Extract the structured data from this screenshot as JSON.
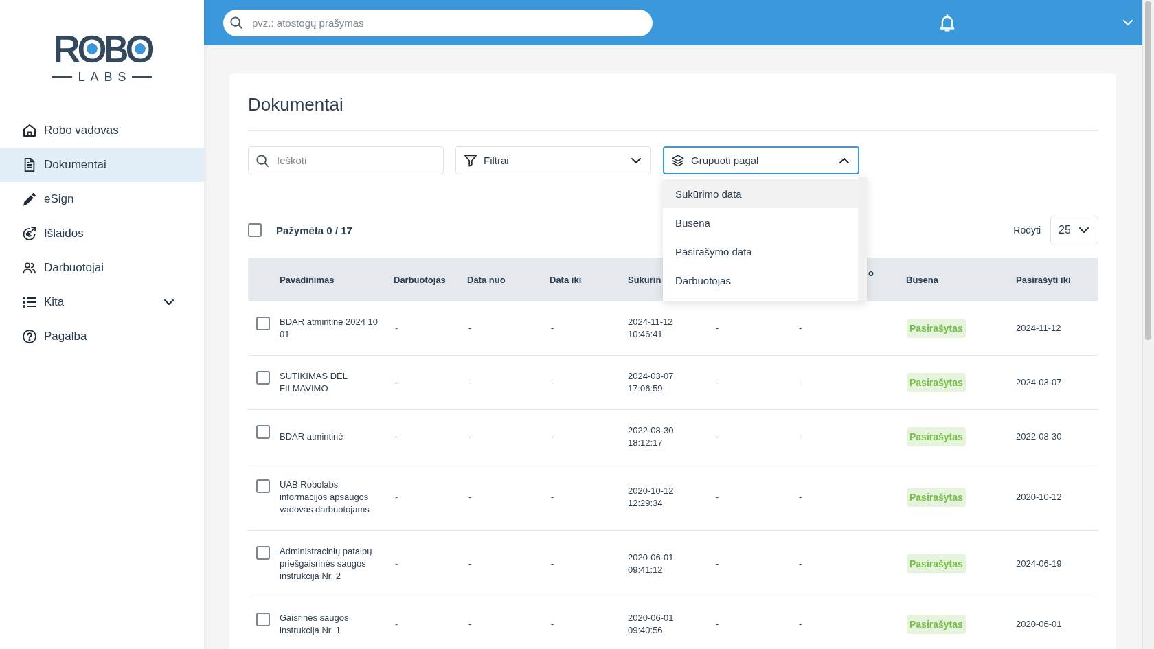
{
  "sidebar": {
    "logo": {
      "wordmark": "ROBO",
      "tagline": "LABS"
    },
    "items": [
      {
        "label": "Robo vadovas",
        "kind": "link",
        "selected": false
      },
      {
        "label": "Dokumentai",
        "kind": "link",
        "selected": true
      },
      {
        "label": "eSign",
        "kind": "link",
        "selected": false
      },
      {
        "label": "Išlaidos",
        "kind": "link",
        "selected": false
      },
      {
        "label": "Darbuotojai",
        "kind": "link",
        "selected": false
      },
      {
        "label": "Kita",
        "kind": "group",
        "selected": false,
        "expanded": false
      },
      {
        "label": "Pagalba",
        "kind": "link",
        "selected": false
      }
    ]
  },
  "topbar": {
    "search": {
      "placeholder": "pvz.: atostogų prašymas"
    }
  },
  "page": {
    "title": "Dokumentai"
  },
  "toolbar": {
    "search": {
      "placeholder": "Ieškoti"
    },
    "filters": {
      "label": "Filtrai",
      "expanded": false
    },
    "group_by": {
      "label": "Grupuoti pagal",
      "expanded": true,
      "options": [
        {
          "label": "Sukūrimo data",
          "selected": true
        },
        {
          "label": "Būsena",
          "selected": false
        },
        {
          "label": "Pasirašymo data",
          "selected": false
        },
        {
          "label": "Darbuotojas",
          "selected": false
        }
      ]
    }
  },
  "selection": {
    "checked": false,
    "label": "Pažymėta 0 / 17"
  },
  "page_size": {
    "label": "Rodyti",
    "value": "25"
  },
  "table": {
    "columns": [
      {
        "label": "Pavadinimas",
        "kind": "name"
      },
      {
        "label": "Darbuotojas",
        "kind": "text"
      },
      {
        "label": "Data nuo",
        "kind": "text"
      },
      {
        "label": "Data iki",
        "kind": "text"
      },
      {
        "label": "Sukūrin",
        "kind": "datetime"
      },
      {
        "kind": "text"
      },
      {
        "label": "o",
        "kind": "text"
      },
      {
        "label": "Būsena",
        "kind": "status"
      },
      {
        "label": "Pasirašyti iki",
        "kind": "date"
      }
    ],
    "rows": [
      {
        "checked": false,
        "cells": [
          "BDAR atmintinė 2024 10 01",
          "-",
          "-",
          "-",
          "2024-11-12 10:46:41",
          "-",
          "-",
          "Pasirašytas",
          "2024-11-12"
        ]
      },
      {
        "checked": false,
        "cells": [
          "SUTIKIMAS DĖL FILMAVIMO",
          "-",
          "-",
          "-",
          "2024-03-07 17:06:59",
          "-",
          "-",
          "Pasirašytas",
          "2024-03-07"
        ]
      },
      {
        "checked": false,
        "cells": [
          "BDAR atmintinė",
          "-",
          "-",
          "-",
          "2022-08-30 18:12:17",
          "-",
          "-",
          "Pasirašytas",
          "2022-08-30"
        ]
      },
      {
        "checked": false,
        "cells": [
          "UAB Robolabs informacijos apsaugos vadovas darbuotojams",
          "-",
          "-",
          "-",
          "2020-10-12 12:29:34",
          "-",
          "-",
          "Pasirašytas",
          "2020-10-12"
        ]
      },
      {
        "checked": false,
        "cells": [
          "Administracinių patalpų priešgaisrinės saugos instrukcija Nr. 2",
          "-",
          "-",
          "-",
          "2020-06-01 09:41:12",
          "-",
          "-",
          "Pasirašytas",
          "2024-06-19"
        ]
      },
      {
        "checked": false,
        "cells": [
          "Gaisrinės saugos instrukcija Nr. 1",
          "-",
          "-",
          "-",
          "2020-06-01 09:40:56",
          "-",
          "-",
          "Pasirašytas",
          "2020-06-01"
        ]
      }
    ]
  }
}
